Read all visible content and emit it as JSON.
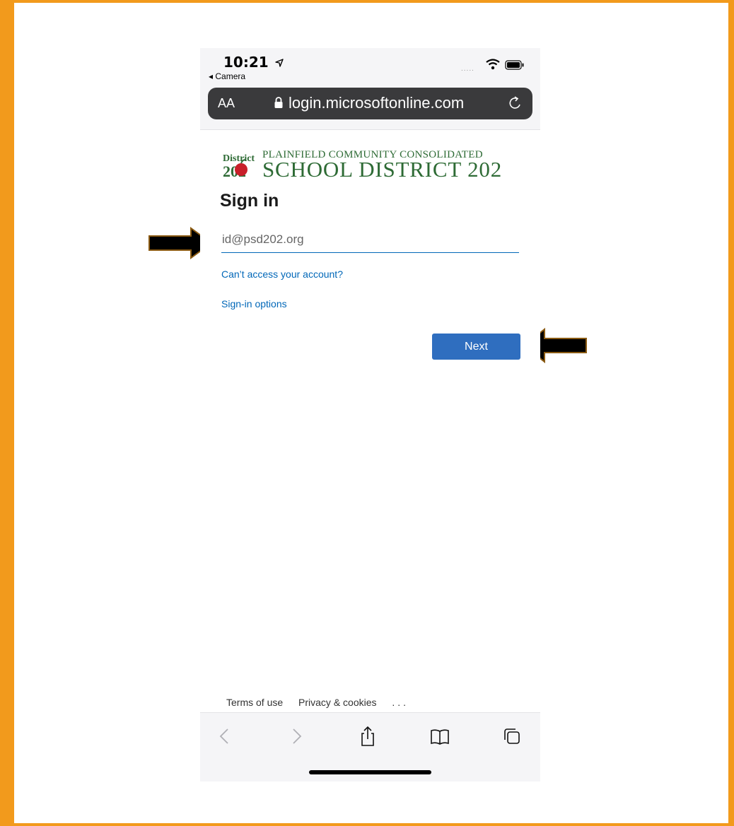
{
  "status": {
    "time": "10:21",
    "back_label": "◂ Camera",
    "signal_dots": "....."
  },
  "browser": {
    "text_size_label": "AA",
    "url": "login.microsoftonline.com"
  },
  "logo": {
    "mark_top": "District",
    "mark_bottom": "202",
    "line1": "PLAINFIELD COMMUNITY CONSOLIDATED",
    "line2": "SCHOOL DISTRICT 202"
  },
  "signin": {
    "title": "Sign in",
    "email_placeholder": "id@psd202.org",
    "cant_access": "Can’t access your account?",
    "signin_options": "Sign-in options",
    "next_label": "Next"
  },
  "footer": {
    "terms": "Terms of use",
    "privacy": "Privacy & cookies",
    "more": "..."
  },
  "colors": {
    "frame": "#F29A1C",
    "accent": "#2F6EBF",
    "link": "#0067B8",
    "logo_green": "#2E6B35",
    "urlbar": "#3A3A3C"
  },
  "icons": [
    "location-arrow-icon",
    "wifi-icon",
    "battery-icon",
    "lock-icon",
    "reload-icon",
    "back-icon",
    "forward-icon",
    "share-icon",
    "bookmarks-icon",
    "tabs-icon",
    "arrow-right-icon",
    "arrow-left-icon"
  ]
}
